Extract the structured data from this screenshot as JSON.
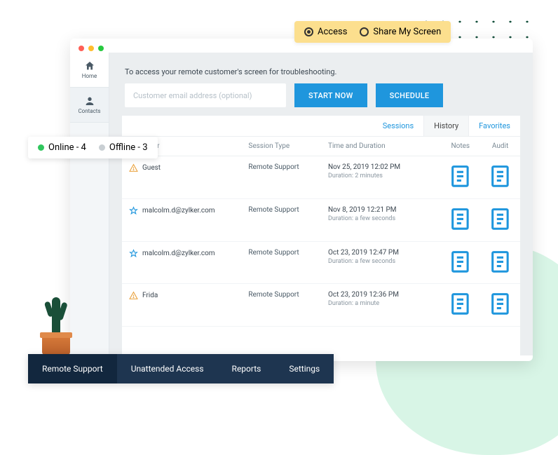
{
  "mode": {
    "access": "Access",
    "share": "Share My Screen"
  },
  "sidebar": {
    "home": "Home",
    "contacts": "Contacts"
  },
  "hero": {
    "tagline": "To access your remote customer's screen for troubleshooting.",
    "placeholder": "Customer email address (optional)",
    "start": "START NOW",
    "schedule": "SCHEDULE"
  },
  "status": {
    "online_label": "Online - 4",
    "offline_label": "Offline - 3"
  },
  "tabs": {
    "sessions": "Sessions",
    "history": "History",
    "favorites": "Favorites"
  },
  "cols": {
    "customer": "Customer",
    "type": "Session Type",
    "time": "Time and Duration",
    "notes": "Notes",
    "audit": "Audit"
  },
  "rows": [
    {
      "icon": "warn",
      "name": "Guest",
      "type": "Remote Support",
      "time": "Nov 25, 2019 12:02 PM",
      "dur": "Duration: 2 minutes"
    },
    {
      "icon": "star",
      "name": "malcolm.d@zylker.com",
      "type": "Remote Support",
      "time": "Nov 8, 2019 12:21 PM",
      "dur": "Duration: a few seconds"
    },
    {
      "icon": "star",
      "name": "malcolm.d@zylker.com",
      "type": "Remote Support",
      "time": "Oct 23, 2019 12:47 PM",
      "dur": "Duration: a few seconds"
    },
    {
      "icon": "warn",
      "name": "Frida",
      "type": "Remote Support",
      "time": "Oct 23, 2019 12:36 PM",
      "dur": "Duration: a minute"
    }
  ],
  "bottom": {
    "remote": "Remote Support",
    "unattended": "Unattended Access",
    "reports": "Reports",
    "settings": "Settings"
  }
}
